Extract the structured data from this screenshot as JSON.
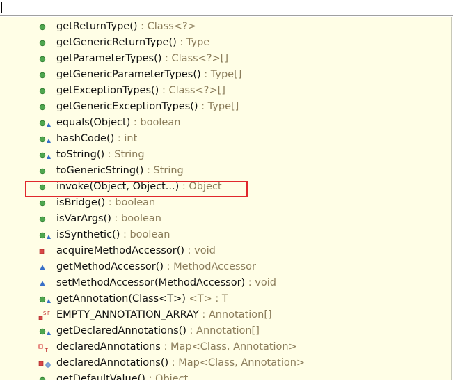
{
  "colors": {
    "public": "#4fa64f",
    "protected": "#3870c8",
    "private": "#d94848",
    "background": "#fffee6",
    "type_text": "#8b7d5b",
    "highlight": "#e0282d"
  },
  "filter": {
    "value": ""
  },
  "items": [
    {
      "name": "getReturnType()",
      "type": " : Class<?>",
      "icon": "public-method-icon"
    },
    {
      "name": "getGenericReturnType()",
      "type": " : Type",
      "icon": "public-method-icon"
    },
    {
      "name": "getParameterTypes()",
      "type": " : Class<?>[]",
      "icon": "public-method-icon"
    },
    {
      "name": "getGenericParameterTypes()",
      "type": " : Type[]",
      "icon": "public-method-icon"
    },
    {
      "name": "getExceptionTypes()",
      "type": " : Class<?>[]",
      "icon": "public-method-icon"
    },
    {
      "name": "getGenericExceptionTypes()",
      "type": " : Type[]",
      "icon": "public-method-icon"
    },
    {
      "name": "equals(Object)",
      "type": " : boolean",
      "icon": "public-override-method-icon"
    },
    {
      "name": "hashCode()",
      "type": " : int",
      "icon": "public-override-method-icon"
    },
    {
      "name": "toString()",
      "type": " : String",
      "icon": "public-override-method-icon"
    },
    {
      "name": "toGenericString()",
      "type": " : String",
      "icon": "public-method-icon"
    },
    {
      "name": "invoke(Object, Object...)",
      "type": " : Object",
      "icon": "public-method-icon",
      "highlighted": true
    },
    {
      "name": "isBridge()",
      "type": " : boolean",
      "icon": "public-method-icon"
    },
    {
      "name": "isVarArgs()",
      "type": " : boolean",
      "icon": "public-method-icon"
    },
    {
      "name": "isSynthetic()",
      "type": " : boolean",
      "icon": "public-override-method-icon"
    },
    {
      "name": "acquireMethodAccessor()",
      "type": " : void",
      "icon": "private-method-icon"
    },
    {
      "name": "getMethodAccessor()",
      "type": " : MethodAccessor",
      "icon": "default-method-icon"
    },
    {
      "name": "setMethodAccessor(MethodAccessor)",
      "type": " : void",
      "icon": "default-method-icon"
    },
    {
      "name": "getAnnotation(Class<T>)",
      "type": " <T> : T",
      "icon": "public-override-method-icon"
    },
    {
      "name": "EMPTY_ANNOTATION_ARRAY",
      "type": " : Annotation[]",
      "icon": "private-static-final-field-icon"
    },
    {
      "name": "getDeclaredAnnotations()",
      "type": " : Annotation[]",
      "icon": "public-override-method-icon"
    },
    {
      "name": "declaredAnnotations",
      "type": " : Map<Class, Annotation>",
      "icon": "private-transient-field-icon"
    },
    {
      "name": "declaredAnnotations()",
      "type": " : Map<Class, Annotation>",
      "icon": "private-synchronized-method-icon"
    },
    {
      "name": "getDefaultValue()",
      "type": " : Object",
      "icon": "public-method-icon"
    }
  ]
}
